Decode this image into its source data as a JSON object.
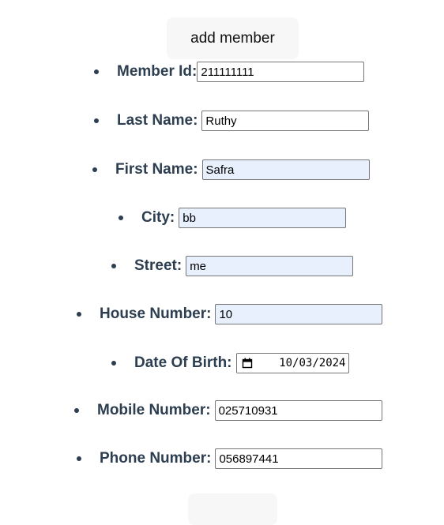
{
  "header": {
    "add_member_label": "add member"
  },
  "form": {
    "member_id": {
      "label": "Member Id:",
      "value": "211111111"
    },
    "last_name": {
      "label": "Last Name:",
      "value": "Ruthy"
    },
    "first_name": {
      "label": "First Name:",
      "value": "Safra"
    },
    "city": {
      "label": "City:",
      "value": "bb"
    },
    "street": {
      "label": "Street:",
      "value": "me"
    },
    "house_number": {
      "label": "House Number:",
      "value": "10"
    },
    "date_of_birth": {
      "label": "Date Of Birth:",
      "value": "10/03/2024"
    },
    "mobile_number": {
      "label": "Mobile Number:",
      "value": "025710931"
    },
    "phone_number": {
      "label": "Phone Number:",
      "value": "056897441"
    }
  },
  "colors": {
    "label_text": "#2c3e50",
    "autofill_bg": "#e8f0fe",
    "button_bg": "#f7f7f7"
  }
}
